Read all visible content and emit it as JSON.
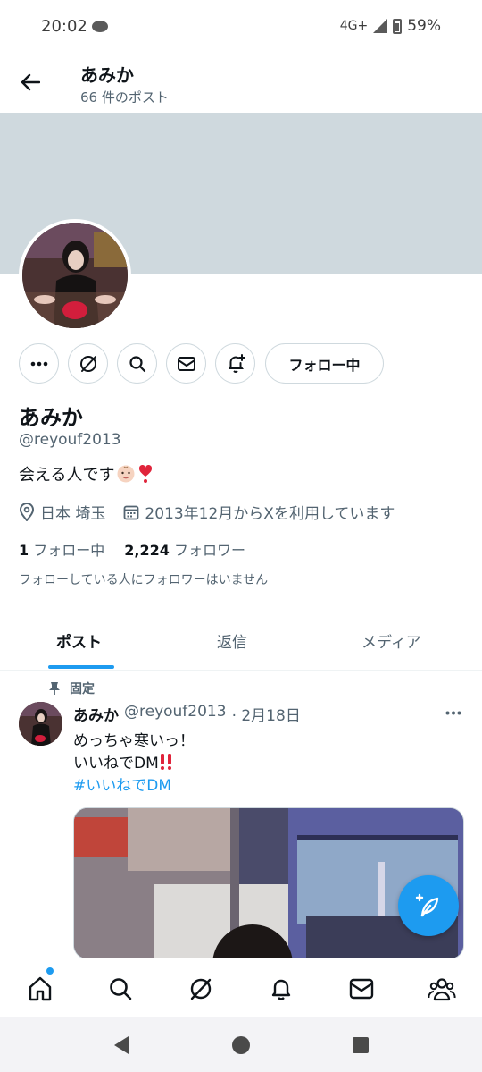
{
  "status_bar": {
    "time": "20:02",
    "network": "4G+",
    "battery": "59%"
  },
  "header": {
    "name": "あみか",
    "post_count": "66 件のポスト"
  },
  "actions": {
    "follow_label": "フォロー中"
  },
  "profile": {
    "name": "あみか",
    "handle": "@reyouf2013",
    "bio": "会える人です",
    "location": "日本 埼玉",
    "joined": "2013年12月からXを利用しています",
    "following_count": "1",
    "following_label": "フォロー中",
    "followers_count": "2,224",
    "followers_label": "フォロワー",
    "known_followers": "フォローしている人にフォロワーはいません"
  },
  "tabs": [
    {
      "label": "ポスト",
      "active": true
    },
    {
      "label": "返信",
      "active": false
    },
    {
      "label": "メディア",
      "active": false
    }
  ],
  "post": {
    "pinned_label": "固定",
    "name": "あみか",
    "handle": "@reyouf2013",
    "date": "· 2月18日",
    "line1": "めっちゃ寒いっ！",
    "line2": "いいねでDM",
    "hashtag": "#いいねでDM"
  },
  "colors": {
    "accent": "#1d9bf0",
    "banner": "#cfd9de",
    "text_secondary": "#536471"
  },
  "icons": {
    "back": "arrow-left-icon",
    "more": "more-horizontal-icon",
    "grok": "grok-icon",
    "search": "search-icon",
    "message": "envelope-icon",
    "notify": "bell-plus-icon",
    "location": "location-pin-icon",
    "calendar": "calendar-icon",
    "pin": "pin-icon",
    "fab": "compose-icon",
    "nav": [
      "home-icon",
      "search-icon",
      "grok-icon",
      "bell-icon",
      "envelope-icon",
      "communities-icon"
    ]
  }
}
